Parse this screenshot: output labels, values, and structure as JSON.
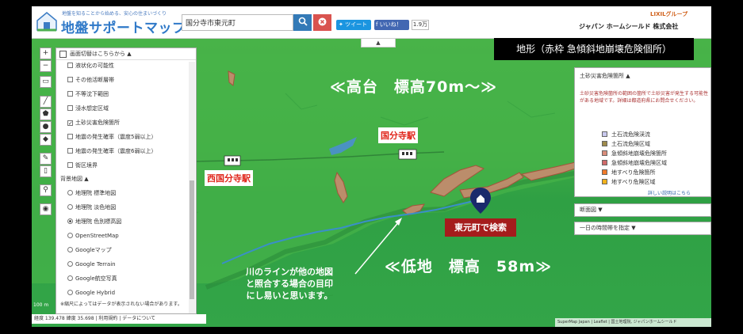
{
  "header": {
    "tagline": "地盤を知ることから始める、安心の住まいづくり",
    "title": "地盤サポートマップ",
    "search_value": "国分寺市東元町",
    "tweet_label": "ツイート",
    "fb_label": "いいね！",
    "fb_count": "1.9万",
    "brand_group": "LIXILグループ",
    "brand_name": "ジャパン ホームシールド 株式会社"
  },
  "toolbar": {
    "zoom_in": "+",
    "zoom_out": "−"
  },
  "left_panel": {
    "header": "画面切替はこちらから ▲",
    "layers": [
      {
        "label": "液状化の可能性",
        "checked": false
      },
      {
        "label": "その他活断層帯",
        "checked": false
      },
      {
        "label": "不等沈下範囲",
        "checked": false
      },
      {
        "label": "浸水想定区域",
        "checked": false
      },
      {
        "label": "土砂災害危険箇所",
        "checked": true
      },
      {
        "label": "地震の発生確率（震度5弱以上）",
        "checked": false
      },
      {
        "label": "地震の発生確率（震度6弱以上）",
        "checked": false
      },
      {
        "label": "街区境界",
        "checked": false
      }
    ],
    "background_header": "背景地図 ▲",
    "backgrounds": [
      {
        "label": "地理院 標準地図",
        "selected": false
      },
      {
        "label": "地理院 淡色地図",
        "selected": false
      },
      {
        "label": "地理院 色別標高図",
        "selected": true
      },
      {
        "label": "OpenStreetMap",
        "selected": false
      },
      {
        "label": "Googleマップ",
        "selected": false
      },
      {
        "label": "Google Terrain",
        "selected": false
      },
      {
        "label": "Google航空写真",
        "selected": false
      },
      {
        "label": "Google Hybrid",
        "selected": false
      }
    ],
    "note": "※縮尺によってはデータが表示されない場合があります。"
  },
  "legend": {
    "title": "土砂災害危険箇所 ▲",
    "description": "土砂災害危険箇所の範囲の箇所で土砂災害が発生する可能性がある地域です。詳細は都道府県にお問合せください。",
    "items": [
      {
        "label": "土石流危険渓流",
        "color": "#c9c9ee"
      },
      {
        "label": "土石流危険区域",
        "color": "#9e8b4b"
      },
      {
        "label": "急傾斜地崩壊危険箇所",
        "color": "#d88c7a"
      },
      {
        "label": "急傾斜地崩壊危険区域",
        "color": "#d06a6a"
      },
      {
        "label": "地すべり危険箇所",
        "color": "#f07a2a"
      },
      {
        "label": "地すべり危険区域",
        "color": "#f2b21c"
      }
    ],
    "link": "詳しい説明はこちら"
  },
  "collapsibles": [
    {
      "label": "断面図 ▼"
    },
    {
      "label": "一日の時間帯を指定 ▼"
    }
  ],
  "annotations": {
    "caption": "地形（赤枠 急傾斜地崩壊危険個所）",
    "highland": "≪高台　標高70m～≫",
    "lowland": "≪低地　標高　58m≫",
    "station_kokubunji": "国分寺駅",
    "station_nishi": "西国分寺駅",
    "search_marker": "東元町で検索",
    "river_note_1": "川のラインが他の地図",
    "river_note_2": "と照合する場合の目印",
    "river_note_3": "にし易いと思います。"
  },
  "status": {
    "coords": "経度 139.478 緯度 35.698 | 利用規約 | データについて",
    "attribution": "SuperMap Japan | Leaflet | 国土地理院, ジャパンホームシールド",
    "scale": "100 m"
  },
  "colors": {
    "map_green": "#3aa845",
    "slope_red": "#d88c7a",
    "accent_blue": "#2f79c8"
  }
}
